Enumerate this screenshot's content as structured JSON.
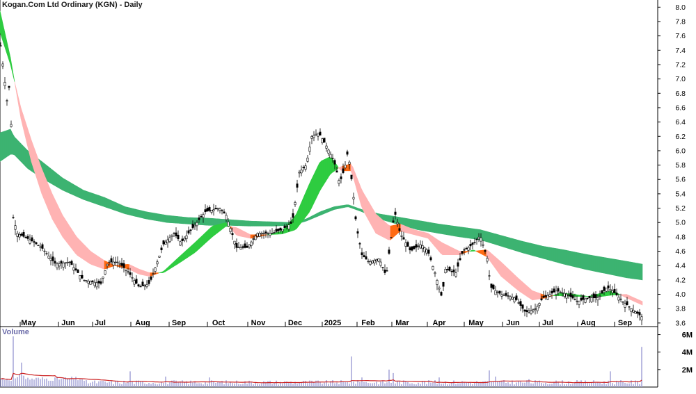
{
  "chart_data": {
    "type": "candlestick",
    "title": "Kogan.Com Ltd Ordinary (KGN) - Daily",
    "volume_label": "Volume",
    "x_tick_labels": [
      "May",
      "Jun",
      "Jul",
      "Aug",
      "Sep",
      "Oct",
      "Nov",
      "Dec",
      "2025",
      "Feb",
      "Mar",
      "Apr",
      "May",
      "Jun",
      "Jul",
      "Aug",
      "Sep"
    ],
    "y_ticks": [
      3.6,
      3.8,
      4.0,
      4.2,
      4.4,
      4.6,
      4.8,
      5.0,
      5.2,
      5.4,
      5.6,
      5.8,
      6.0,
      6.2,
      6.4,
      6.6,
      6.8,
      7.0,
      7.2,
      7.4,
      7.6,
      7.8,
      8.0
    ],
    "y_tick_labels": [
      "3.6",
      "3.8",
      "4.0",
      "4.2",
      "4.4",
      "4.6",
      "4.8",
      "5.0",
      "5.2",
      "5.4",
      "5.6",
      "5.8",
      "6.0",
      "6.2",
      "6.4",
      "6.6",
      "6.8",
      "7.0",
      "7.2",
      "7.4",
      "7.6",
      "7.8",
      "8.0"
    ],
    "ylim": [
      3.55,
      8.1
    ],
    "volume_ticks": [
      2000000,
      4000000,
      6000000
    ],
    "volume_tick_labels": [
      "2M",
      "4M",
      "6M"
    ],
    "volume_ylim": [
      0,
      6600000
    ],
    "grid": false,
    "colors": {
      "candle": "#000000",
      "short_bull": "#2ecc40",
      "short_bear": "#ff6a13",
      "long_bull": "#3cb371",
      "long_bear": "#ff6a13",
      "long_bear_fade": "#f46a6a",
      "short_bear_fade": "#ffb3b3",
      "volume": "#9d9dd4",
      "volume_avg": "#cc2222"
    },
    "price_keypoints": [
      {
        "x": 0,
        "y": 7.55
      },
      {
        "x": 10,
        "y": 6.7
      },
      {
        "x": 15,
        "y": 7.0
      },
      {
        "x": 18,
        "y": 5.1
      },
      {
        "x": 25,
        "y": 4.85
      },
      {
        "x": 45,
        "y": 4.75
      },
      {
        "x": 60,
        "y": 4.65
      },
      {
        "x": 80,
        "y": 4.42
      },
      {
        "x": 100,
        "y": 4.45
      },
      {
        "x": 120,
        "y": 4.2
      },
      {
        "x": 145,
        "y": 4.15
      },
      {
        "x": 155,
        "y": 4.45
      },
      {
        "x": 170,
        "y": 4.45
      },
      {
        "x": 185,
        "y": 4.3
      },
      {
        "x": 200,
        "y": 4.1
      },
      {
        "x": 215,
        "y": 4.15
      },
      {
        "x": 235,
        "y": 4.7
      },
      {
        "x": 250,
        "y": 4.85
      },
      {
        "x": 260,
        "y": 4.72
      },
      {
        "x": 275,
        "y": 4.9
      },
      {
        "x": 295,
        "y": 5.15
      },
      {
        "x": 315,
        "y": 5.2
      },
      {
        "x": 325,
        "y": 5.1
      },
      {
        "x": 340,
        "y": 4.65
      },
      {
        "x": 355,
        "y": 4.65
      },
      {
        "x": 370,
        "y": 4.85
      },
      {
        "x": 390,
        "y": 4.85
      },
      {
        "x": 405,
        "y": 4.9
      },
      {
        "x": 420,
        "y": 5.0
      },
      {
        "x": 430,
        "y": 5.7
      },
      {
        "x": 440,
        "y": 5.8
      },
      {
        "x": 448,
        "y": 6.2
      },
      {
        "x": 458,
        "y": 6.25
      },
      {
        "x": 470,
        "y": 6.05
      },
      {
        "x": 480,
        "y": 5.85
      },
      {
        "x": 488,
        "y": 5.55
      },
      {
        "x": 495,
        "y": 5.75
      },
      {
        "x": 500,
        "y": 6.0
      },
      {
        "x": 507,
        "y": 5.45
      },
      {
        "x": 512,
        "y": 4.95
      },
      {
        "x": 520,
        "y": 4.55
      },
      {
        "x": 530,
        "y": 4.45
      },
      {
        "x": 545,
        "y": 4.5
      },
      {
        "x": 555,
        "y": 4.25
      },
      {
        "x": 560,
        "y": 4.65
      },
      {
        "x": 567,
        "y": 5.15
      },
      {
        "x": 575,
        "y": 4.85
      },
      {
        "x": 590,
        "y": 4.6
      },
      {
        "x": 605,
        "y": 4.7
      },
      {
        "x": 615,
        "y": 4.6
      },
      {
        "x": 625,
        "y": 4.3
      },
      {
        "x": 635,
        "y": 3.95
      },
      {
        "x": 640,
        "y": 4.35
      },
      {
        "x": 655,
        "y": 4.3
      },
      {
        "x": 665,
        "y": 4.6
      },
      {
        "x": 680,
        "y": 4.7
      },
      {
        "x": 690,
        "y": 4.82
      },
      {
        "x": 700,
        "y": 4.5
      },
      {
        "x": 705,
        "y": 4.1
      },
      {
        "x": 720,
        "y": 4.0
      },
      {
        "x": 740,
        "y": 3.95
      },
      {
        "x": 755,
        "y": 3.75
      },
      {
        "x": 770,
        "y": 3.8
      },
      {
        "x": 780,
        "y": 3.95
      },
      {
        "x": 800,
        "y": 4.05
      },
      {
        "x": 815,
        "y": 4.0
      },
      {
        "x": 830,
        "y": 3.9
      },
      {
        "x": 845,
        "y": 3.95
      },
      {
        "x": 860,
        "y": 3.95
      },
      {
        "x": 872,
        "y": 4.1
      },
      {
        "x": 880,
        "y": 4.05
      },
      {
        "x": 895,
        "y": 3.9
      },
      {
        "x": 910,
        "y": 3.78
      },
      {
        "x": 923,
        "y": 3.68
      }
    ],
    "short_ribbon": [
      {
        "x": 0,
        "fast": 7.95,
        "slow": 7.65
      },
      {
        "x": 15,
        "fast": 7.3,
        "slow": 7.2
      },
      {
        "x": 30,
        "fast": 6.45,
        "slow": 6.6
      },
      {
        "x": 45,
        "fast": 5.85,
        "slow": 6.15
      },
      {
        "x": 60,
        "fast": 5.4,
        "slow": 5.75
      },
      {
        "x": 75,
        "fast": 5.05,
        "slow": 5.4
      },
      {
        "x": 90,
        "fast": 4.8,
        "slow": 5.1
      },
      {
        "x": 110,
        "fast": 4.55,
        "slow": 4.8
      },
      {
        "x": 130,
        "fast": 4.42,
        "slow": 4.6
      },
      {
        "x": 150,
        "fast": 4.35,
        "slow": 4.47
      },
      {
        "x": 165,
        "fast": 4.4,
        "slow": 4.4
      },
      {
        "x": 185,
        "fast": 4.35,
        "slow": 4.42
      },
      {
        "x": 200,
        "fast": 4.28,
        "slow": 4.35
      },
      {
        "x": 215,
        "fast": 4.25,
        "slow": 4.3
      },
      {
        "x": 235,
        "fast": 4.32,
        "slow": 4.3
      },
      {
        "x": 255,
        "fast": 4.5,
        "slow": 4.42
      },
      {
        "x": 280,
        "fast": 4.72,
        "slow": 4.58
      },
      {
        "x": 305,
        "fast": 4.95,
        "slow": 4.8
      },
      {
        "x": 325,
        "fast": 5.0,
        "slow": 4.95
      },
      {
        "x": 340,
        "fast": 4.82,
        "slow": 4.93
      },
      {
        "x": 360,
        "fast": 4.78,
        "slow": 4.83
      },
      {
        "x": 385,
        "fast": 4.83,
        "slow": 4.83
      },
      {
        "x": 405,
        "fast": 4.88,
        "slow": 4.84
      },
      {
        "x": 425,
        "fast": 5.1,
        "slow": 4.9
      },
      {
        "x": 445,
        "fast": 5.55,
        "slow": 5.15
      },
      {
        "x": 460,
        "fast": 5.85,
        "slow": 5.45
      },
      {
        "x": 475,
        "fast": 5.92,
        "slow": 5.68
      },
      {
        "x": 490,
        "fast": 5.72,
        "slow": 5.78
      },
      {
        "x": 505,
        "fast": 5.72,
        "slow": 5.82
      },
      {
        "x": 520,
        "fast": 5.2,
        "slow": 5.45
      },
      {
        "x": 540,
        "fast": 4.85,
        "slow": 5.12
      },
      {
        "x": 560,
        "fast": 4.75,
        "slow": 4.95
      },
      {
        "x": 575,
        "fast": 4.88,
        "slow": 4.98
      },
      {
        "x": 595,
        "fast": 4.83,
        "slow": 4.9
      },
      {
        "x": 615,
        "fast": 4.78,
        "slow": 4.85
      },
      {
        "x": 635,
        "fast": 4.55,
        "slow": 4.72
      },
      {
        "x": 660,
        "fast": 4.55,
        "slow": 4.6
      },
      {
        "x": 680,
        "fast": 4.62,
        "slow": 4.6
      },
      {
        "x": 700,
        "fast": 4.52,
        "slow": 4.62
      },
      {
        "x": 720,
        "fast": 4.25,
        "slow": 4.45
      },
      {
        "x": 745,
        "fast": 4.05,
        "slow": 4.22
      },
      {
        "x": 765,
        "fast": 3.92,
        "slow": 4.05
      },
      {
        "x": 785,
        "fast": 3.95,
        "slow": 3.98
      },
      {
        "x": 805,
        "fast": 4.02,
        "slow": 3.98
      },
      {
        "x": 825,
        "fast": 4.0,
        "slow": 3.97
      },
      {
        "x": 845,
        "fast": 3.97,
        "slow": 3.97
      },
      {
        "x": 865,
        "fast": 4.02,
        "slow": 3.97
      },
      {
        "x": 880,
        "fast": 4.05,
        "slow": 3.99
      },
      {
        "x": 900,
        "fast": 3.95,
        "slow": 4.0
      },
      {
        "x": 923,
        "fast": 3.85,
        "slow": 3.9
      }
    ],
    "long_ribbon": [
      {
        "x": 0,
        "fast": 6.25,
        "slow": 5.85
      },
      {
        "x": 15,
        "fast": 6.3,
        "slow": 5.95
      },
      {
        "x": 20,
        "fast": 6.2,
        "slow": 5.95
      },
      {
        "x": 40,
        "fast": 6.0,
        "slow": 5.75
      },
      {
        "x": 60,
        "fast": 5.85,
        "slow": 5.62
      },
      {
        "x": 90,
        "fast": 5.62,
        "slow": 5.45
      },
      {
        "x": 120,
        "fast": 5.45,
        "slow": 5.32
      },
      {
        "x": 150,
        "fast": 5.35,
        "slow": 5.22
      },
      {
        "x": 180,
        "fast": 5.22,
        "slow": 5.12
      },
      {
        "x": 210,
        "fast": 5.15,
        "slow": 5.05
      },
      {
        "x": 240,
        "fast": 5.1,
        "slow": 5.0
      },
      {
        "x": 270,
        "fast": 5.07,
        "slow": 4.98
      },
      {
        "x": 300,
        "fast": 5.06,
        "slow": 4.96
      },
      {
        "x": 330,
        "fast": 5.04,
        "slow": 4.96
      },
      {
        "x": 360,
        "fast": 5.02,
        "slow": 4.95
      },
      {
        "x": 390,
        "fast": 5.01,
        "slow": 4.95
      },
      {
        "x": 420,
        "fast": 5.0,
        "slow": 4.96
      },
      {
        "x": 440,
        "fast": 5.05,
        "slow": 5.02
      },
      {
        "x": 460,
        "fast": 5.15,
        "slow": 5.1
      },
      {
        "x": 480,
        "fast": 5.22,
        "slow": 5.18
      },
      {
        "x": 500,
        "fast": 5.25,
        "slow": 5.22
      },
      {
        "x": 520,
        "fast": 5.18,
        "slow": 5.15
      },
      {
        "x": 545,
        "fast": 5.12,
        "slow": 5.05
      },
      {
        "x": 570,
        "fast": 5.08,
        "slow": 4.98
      },
      {
        "x": 600,
        "fast": 5.03,
        "slow": 4.9
      },
      {
        "x": 630,
        "fast": 4.98,
        "slow": 4.85
      },
      {
        "x": 660,
        "fast": 4.94,
        "slow": 4.8
      },
      {
        "x": 690,
        "fast": 4.9,
        "slow": 4.76
      },
      {
        "x": 720,
        "fast": 4.82,
        "slow": 4.67
      },
      {
        "x": 750,
        "fast": 4.74,
        "slow": 4.58
      },
      {
        "x": 780,
        "fast": 4.67,
        "slow": 4.5
      },
      {
        "x": 810,
        "fast": 4.62,
        "slow": 4.42
      },
      {
        "x": 840,
        "fast": 4.56,
        "slow": 4.35
      },
      {
        "x": 870,
        "fast": 4.51,
        "slow": 4.29
      },
      {
        "x": 900,
        "fast": 4.46,
        "slow": 4.23
      },
      {
        "x": 923,
        "fast": 4.42,
        "slow": 4.2
      }
    ],
    "volume_spikes": [
      {
        "x": 18,
        "v": 5800000
      },
      {
        "x": 28,
        "v": 1500000
      },
      {
        "x": 30,
        "v": 2800000
      },
      {
        "x": 34,
        "v": 1300000
      },
      {
        "x": 188,
        "v": 1800000
      },
      {
        "x": 237,
        "v": 2900000
      },
      {
        "x": 238,
        "v": 1200000
      },
      {
        "x": 301,
        "v": 1100000
      },
      {
        "x": 505,
        "v": 3500000
      },
      {
        "x": 520,
        "v": 1100000
      },
      {
        "x": 560,
        "v": 2000000
      },
      {
        "x": 566,
        "v": 1600000
      },
      {
        "x": 632,
        "v": 1100000
      },
      {
        "x": 704,
        "v": 1900000
      },
      {
        "x": 712,
        "v": 1200000
      },
      {
        "x": 760,
        "v": 900000
      },
      {
        "x": 878,
        "v": 1800000
      },
      {
        "x": 923,
        "v": 4600000
      }
    ]
  }
}
